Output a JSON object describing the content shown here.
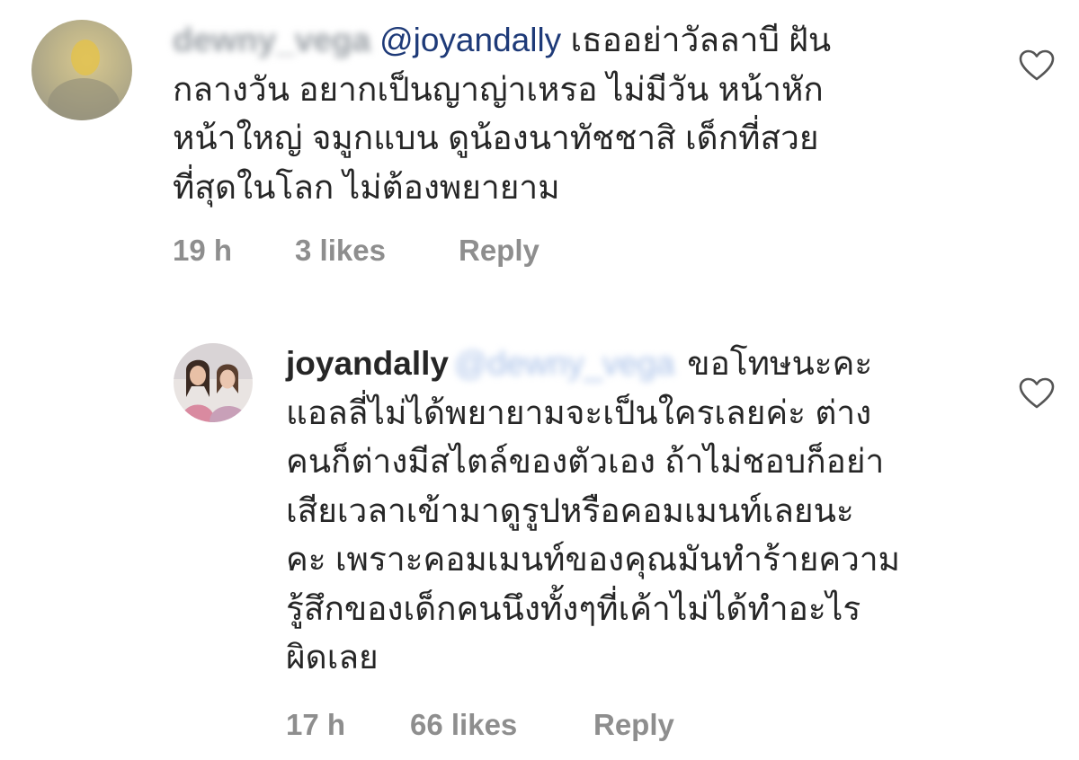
{
  "comments": [
    {
      "username_blurred": "dewny_vega",
      "mention": "@joyandally",
      "lines": [
        "เธออย่าวัลลาบี ฝัน",
        "กลางวัน อยากเป็นญาญ่าเหรอ ไม่มีวัน หน้าหัก",
        "หน้าใหญ่ จมูกแบน ดูน้องนาทัชชาสิ เด็กที่สวย",
        "ที่สุดในโลก ไม่ต้องพยายาม"
      ],
      "time": "19 h",
      "likes": "3 likes",
      "reply": "Reply",
      "like_icon": "heart-outline-icon"
    },
    {
      "username": "joyandally",
      "mention_blurred": "@dewny_vega",
      "lines": [
        "ขอโทษนะคะ",
        "แอลลี่ไม่ได้พยายามจะเป็นใครเลยค่ะ ต่าง",
        "คนก็ต่างมีสไตล์ของตัวเอง ถ้าไม่ชอบก็อย่า",
        "เสียเวลาเข้ามาดูรูปหรือคอมเมนท์เลยนะ",
        "คะ เพราะคอมเมนท์ของคุณมันทำร้ายความ",
        "รู้สึกของเด็กคนนึงทั้งๆที่เค้าไม่ได้ทำอะไร",
        "ผิดเลย"
      ],
      "time": "17 h",
      "likes": "66 likes",
      "reply": "Reply",
      "like_icon": "heart-outline-icon"
    }
  ],
  "colors": {
    "text": "#262626",
    "meta": "#8e8e8e",
    "mention": "#1e3a78"
  }
}
